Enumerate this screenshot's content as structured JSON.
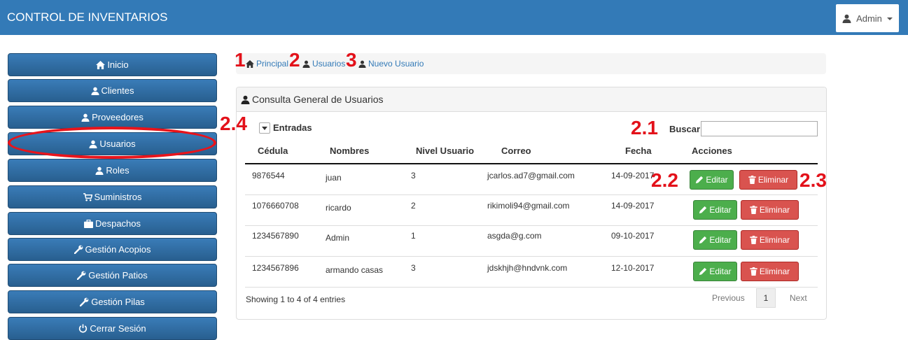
{
  "navbar": {
    "brand": "CONTROL DE INVENTARIOS",
    "user_label": "Admin"
  },
  "sidebar": {
    "items": [
      {
        "label": "Inicio",
        "icon": "home-icon"
      },
      {
        "label": "Clientes",
        "icon": "user-icon"
      },
      {
        "label": "Proveedores",
        "icon": "user-icon"
      },
      {
        "label": "Usuarios",
        "icon": "user-icon"
      },
      {
        "label": "Roles",
        "icon": "user-icon"
      },
      {
        "label": "Suministros",
        "icon": "cart-icon"
      },
      {
        "label": "Despachos",
        "icon": "briefcase-icon"
      },
      {
        "label": "Gestión Acopios",
        "icon": "wrench-icon"
      },
      {
        "label": "Gestión Patios",
        "icon": "wrench-icon"
      },
      {
        "label": "Gestión Pilas",
        "icon": "wrench-icon"
      },
      {
        "label": "Cerrar Sesión",
        "icon": "power-icon"
      }
    ]
  },
  "breadcrumb": {
    "items": [
      "Principal",
      "Usuarios",
      "Nuevo Usuario"
    ]
  },
  "annotations": {
    "a1": "1",
    "a2": "2",
    "a3": "3",
    "a24": "2.4",
    "a21": "2.1",
    "a22": "2.2",
    "a23": "2.3"
  },
  "panel": {
    "title": "Consulta General de Usuarios",
    "entries_label": "Entradas",
    "search_label": "Buscar:",
    "search_value": ""
  },
  "table": {
    "columns": [
      "Cédula",
      "Nombres",
      "Nivel Usuario",
      "Correo",
      "Fecha",
      "Acciones"
    ],
    "rows": [
      [
        "9876544",
        "juan",
        "3",
        "jcarlos.ad7@gmail.com",
        "14-09-2017"
      ],
      [
        "1076660708",
        "ricardo",
        "2",
        "rikimoli94@gmail.com",
        "14-09-2017"
      ],
      [
        "1234567890",
        "Admin",
        "1",
        "asgda@g.com",
        "09-10-2017"
      ],
      [
        "1234567896",
        "armando casas",
        "3",
        "jdskhjh@hndvnk.com",
        "12-10-2017"
      ]
    ],
    "edit_label": "Editar",
    "delete_label": "Eliminar"
  },
  "footer": {
    "info": "Showing 1 to 4 of 4 entries",
    "previous": "Previous",
    "page": "1",
    "next": "Next"
  },
  "colors": {
    "navbar": "#337ab7",
    "sidebar_button": "#2e6da4",
    "edit": "#4cae4c",
    "delete": "#d9534f",
    "annotation": "#e3111a"
  }
}
